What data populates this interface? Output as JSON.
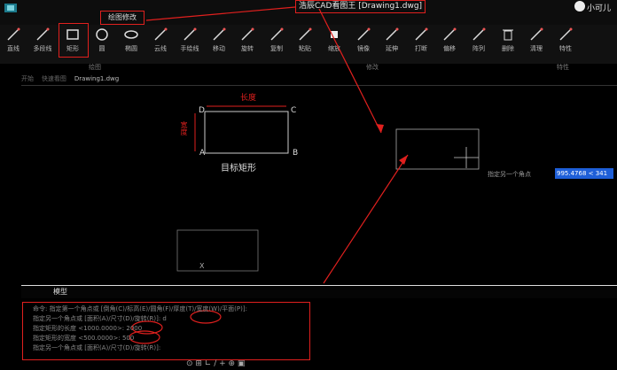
{
  "title": "浩辰CAD看图王 [Drawing1.dwg]",
  "active_menu": "绘图修改",
  "user": "小可儿",
  "ribbon": {
    "tools": [
      {
        "label": "直线",
        "icon": "line-icon"
      },
      {
        "label": "多段线",
        "icon": "polyline-icon"
      },
      {
        "label": "矩形",
        "icon": "rectangle-icon"
      },
      {
        "label": "圆",
        "icon": "circle-icon"
      },
      {
        "label": "椭圆",
        "icon": "ellipse-icon"
      },
      {
        "label": "云线",
        "icon": "cloud-icon"
      },
      {
        "label": "手绘线",
        "icon": "freehand-icon"
      },
      {
        "label": "移动",
        "icon": "move-icon"
      },
      {
        "label": "旋转",
        "icon": "rotate-icon"
      },
      {
        "label": "复制",
        "icon": "copy-icon"
      },
      {
        "label": "粘贴",
        "icon": "paste-icon"
      },
      {
        "label": "缩放",
        "icon": "scale-icon"
      },
      {
        "label": "镜像",
        "icon": "mirror-icon"
      },
      {
        "label": "延伸",
        "icon": "extend-icon"
      },
      {
        "label": "打断",
        "icon": "break-icon"
      },
      {
        "label": "偏移",
        "icon": "offset-icon"
      },
      {
        "label": "阵列",
        "icon": "array-icon"
      },
      {
        "label": "删除",
        "icon": "delete-icon"
      },
      {
        "label": "清理",
        "icon": "purge-icon"
      },
      {
        "label": "特性",
        "icon": "properties-icon"
      }
    ],
    "groups": {
      "draw": "绘图",
      "modify": "修改",
      "layer": "特性"
    }
  },
  "doc_tabs": {
    "home": "开始",
    "recent": "快速看图",
    "active": "Drawing1.dwg"
  },
  "drawing": {
    "width_label": "长度",
    "height_label": "宽度",
    "caption": "目标矩形",
    "corners": {
      "a": "A",
      "b": "B",
      "c": "C",
      "d": "D"
    },
    "point_x": "X"
  },
  "prompt": {
    "label": "指定另一个角点",
    "value": "995.4768 < 341"
  },
  "model_tab": "模型",
  "command_lines": [
    "命令: 指定第一个角点或 [倒角(C)/标高(E)/圆角(F)/厚度(T)/宽度(W)/平面(P)]:",
    "指定另一个角点或 [面积(A)/尺寸(D)/旋转(R)]: d",
    "指定矩形的长度 <1000.0000>: 2000",
    "指定矩形的宽度 <500.0000>: 500",
    "指定另一个角点或 [面积(A)/尺寸(D)/旋转(R)]:"
  ],
  "status_icons": "⊙ ⊞ ∟ / + ⊕ ▣"
}
